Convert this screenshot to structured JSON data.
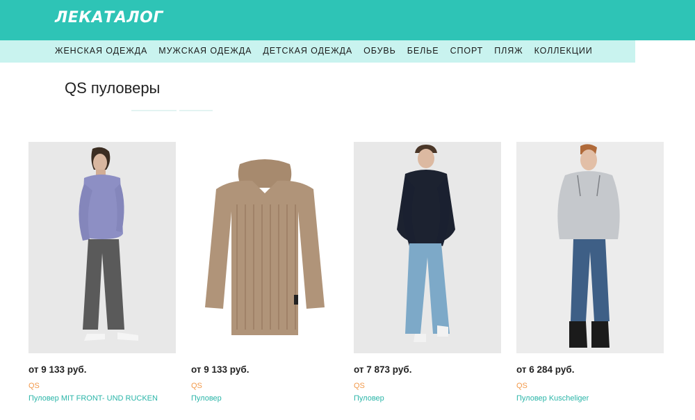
{
  "header": {
    "logo": "ЛЕКАТАЛОГ"
  },
  "nav": {
    "items": [
      "ЖЕНСКАЯ ОДЕЖДА",
      "МУЖСКАЯ ОДЕЖДА",
      "ДЕТСКАЯ ОДЕЖДА",
      "ОБУВЬ",
      "БЕЛЬЕ",
      "СПОРТ",
      "ПЛЯЖ",
      "КОЛЛЕКЦИИ"
    ]
  },
  "page": {
    "title": "QS пуловеры"
  },
  "products": [
    {
      "price": "от 9 133 руб.",
      "brand": "QS",
      "name": "Пуловер MIT FRONT- UND RUCKEN",
      "image": "man-lavender-hoodie-photo"
    },
    {
      "price": "от 9 133 руб.",
      "brand": "QS",
      "name": "Пуловер",
      "image": "beige-knit-hoodie-photo"
    },
    {
      "price": "от 7 873 руб.",
      "brand": "QS",
      "name": "Пуловер",
      "image": "man-navy-hoodie-photo"
    },
    {
      "price": "от 6 284 руб.",
      "brand": "QS",
      "name": "Пуловер Kuscheliger",
      "image": "man-grey-hoodie-photo"
    }
  ],
  "colors": {
    "header_bg": "#2ec4b6",
    "nav_bg": "#c9f3ef",
    "brand_text": "#f2994a",
    "product_name_text": "#2ab5a8"
  }
}
